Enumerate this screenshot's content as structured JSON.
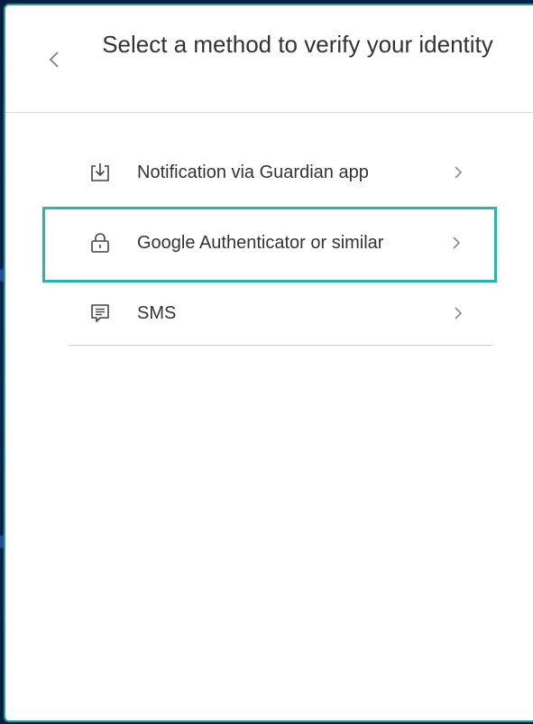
{
  "header": {
    "title": "Select a method to verify your identity",
    "back_icon": "chevron-left-icon"
  },
  "methods": [
    {
      "label": "Notification via Guardian app",
      "icon": "download-tray-icon",
      "highlighted": false
    },
    {
      "label": "Google Authenticator or similar",
      "icon": "lock-icon",
      "highlighted": true
    },
    {
      "label": "SMS",
      "icon": "message-icon",
      "highlighted": false
    }
  ],
  "colors": {
    "accent": "#2bb5aa",
    "text": "#333333",
    "background": "#0b1d40"
  }
}
